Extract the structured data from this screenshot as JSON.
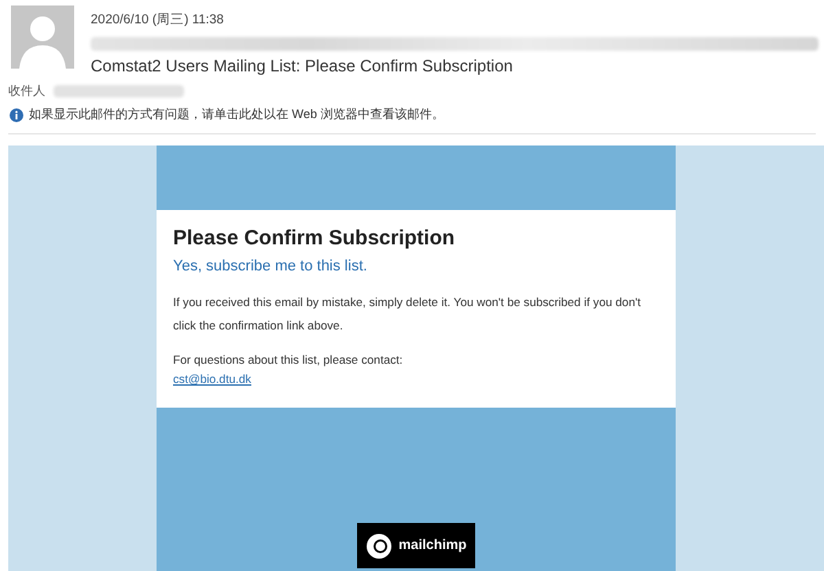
{
  "header": {
    "date": "2020/6/10 (周三) 11:38",
    "subject": "Comstat2 Users Mailing List: Please Confirm Subscription",
    "to_label": "收件人",
    "notice": "如果显示此邮件的方式有问题，请单击此处以在 Web 浏览器中查看该邮件。"
  },
  "email": {
    "title": "Please Confirm Subscription",
    "confirm_link": "Yes, subscribe me to this list.",
    "body": "If you received this email by mistake, simply delete it. You won't be subscribed if you don't click the confirmation link above.",
    "contact_text": "For questions about this list, please contact:",
    "contact_email": "cst@bio.dtu.dk",
    "footer_logo": "mailchimp"
  }
}
